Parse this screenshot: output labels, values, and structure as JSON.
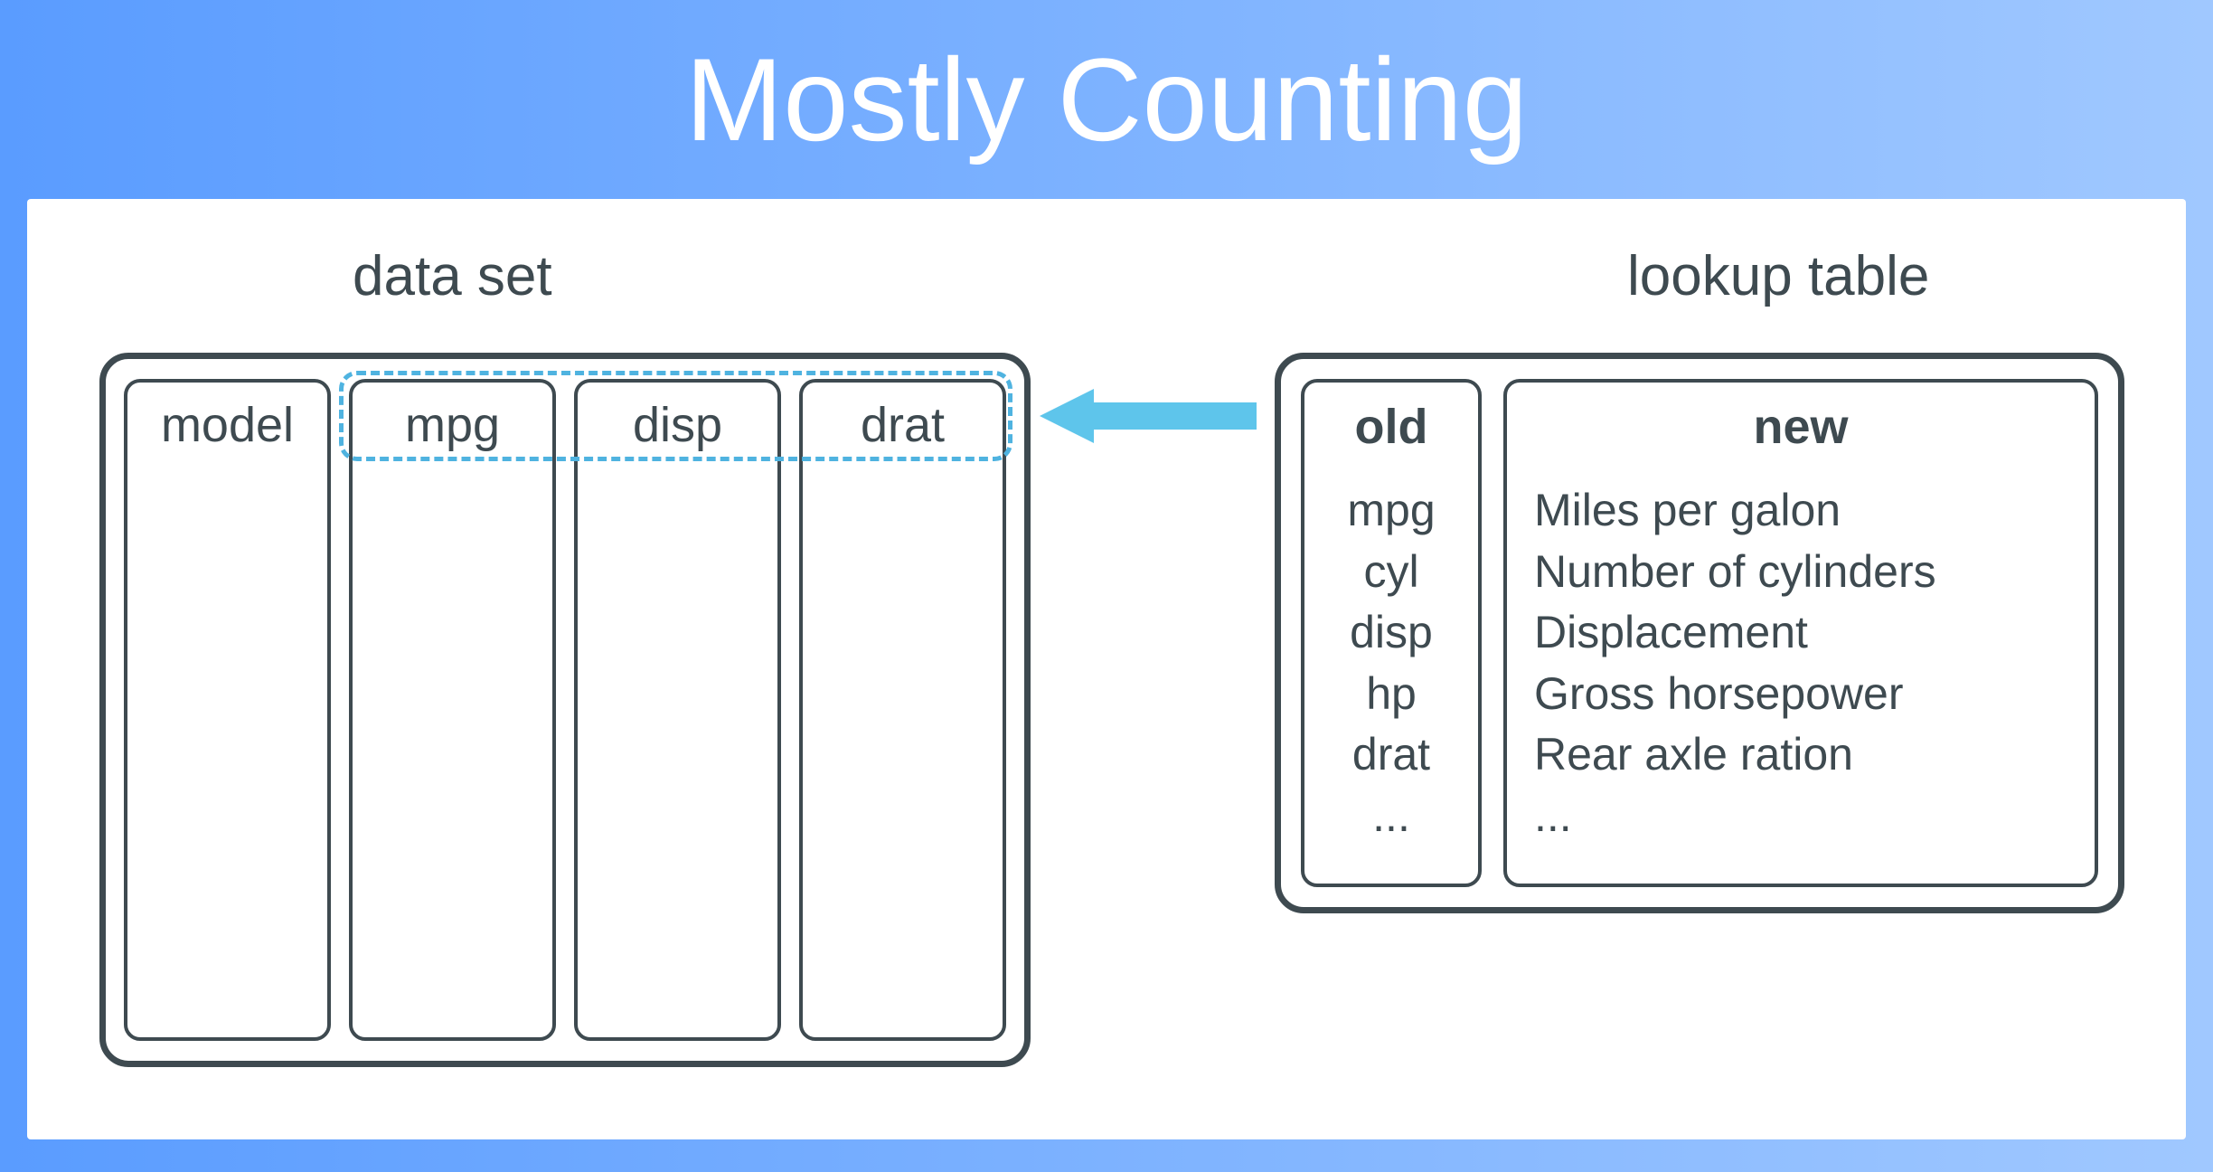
{
  "title": "Mostly Counting",
  "dataset": {
    "label": "data set",
    "columns": [
      "model",
      "mpg",
      "disp",
      "drat"
    ]
  },
  "lookup": {
    "label": "lookup table",
    "old_header": "old",
    "new_header": "new",
    "rows": [
      {
        "old": "mpg",
        "new": "Miles per galon"
      },
      {
        "old": "cyl",
        "new": "Number of cylinders"
      },
      {
        "old": "disp",
        "new": "Displacement"
      },
      {
        "old": "hp",
        "new": "Gross horsepower"
      },
      {
        "old": "drat",
        "new": "Rear axle ration"
      },
      {
        "old": "...",
        "new": "..."
      }
    ]
  },
  "colors": {
    "accent": "#5ec5eb",
    "text": "#3e4a50"
  }
}
